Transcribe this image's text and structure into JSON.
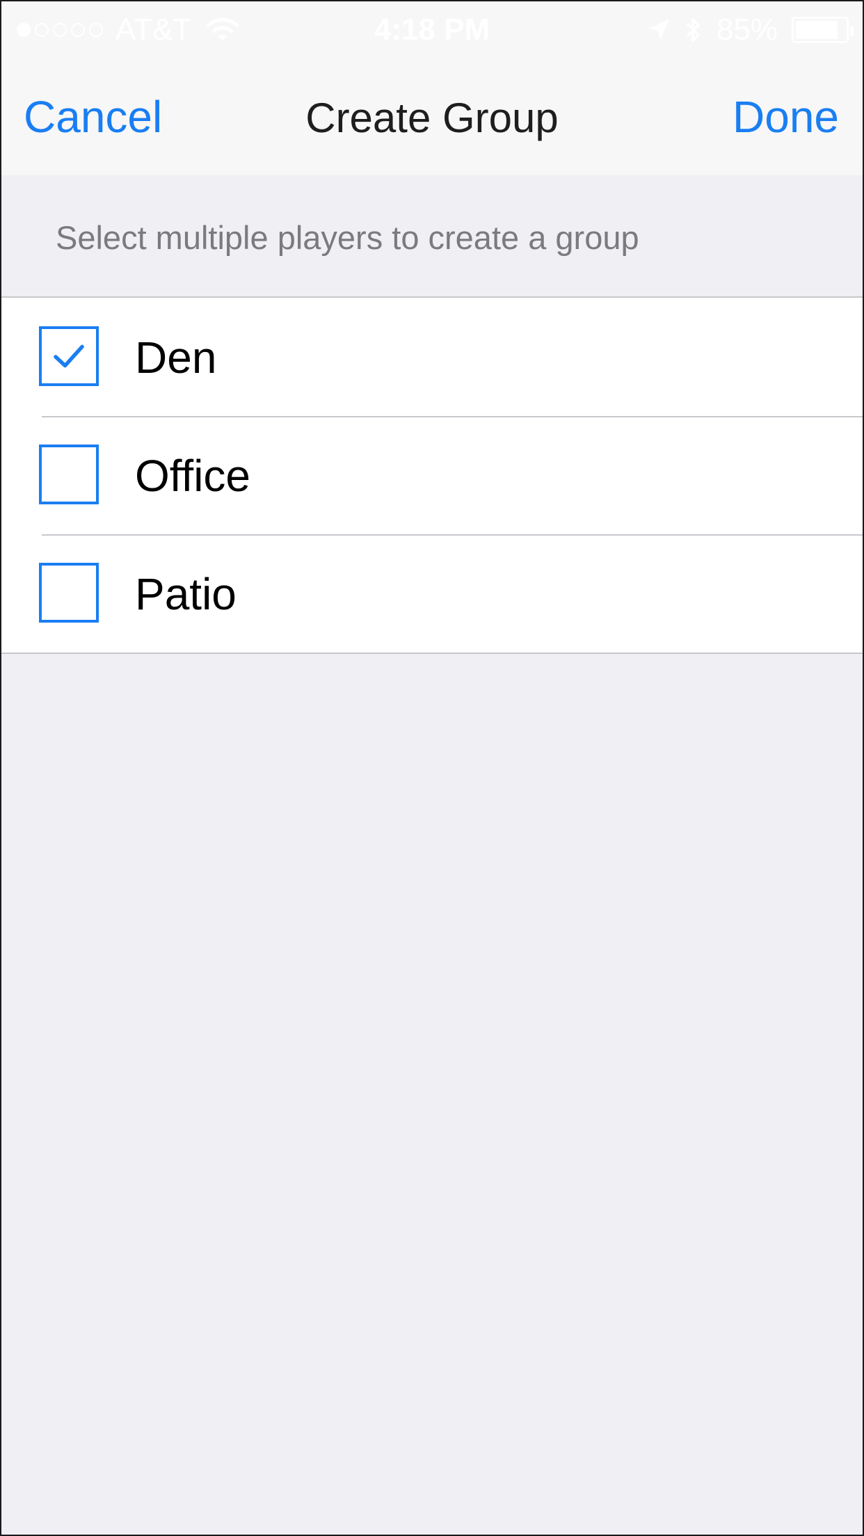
{
  "status_bar": {
    "carrier": "AT&T",
    "signal_bars_filled": 1,
    "signal_bars_total": 5,
    "time": "4:18 PM",
    "battery_percent": "85%",
    "icons": [
      "wifi-icon",
      "location-arrow-icon",
      "bluetooth-icon",
      "battery-icon"
    ]
  },
  "nav": {
    "cancel_label": "Cancel",
    "title": "Create Group",
    "done_label": "Done"
  },
  "section": {
    "header": "Select multiple players to create a group"
  },
  "players": [
    {
      "name": "Den",
      "checked": true
    },
    {
      "name": "Office",
      "checked": false
    },
    {
      "name": "Patio",
      "checked": false
    }
  ],
  "colors": {
    "accent": "#1a7ef2",
    "background": "#efeff4",
    "nav_background": "#f7f7f7"
  }
}
